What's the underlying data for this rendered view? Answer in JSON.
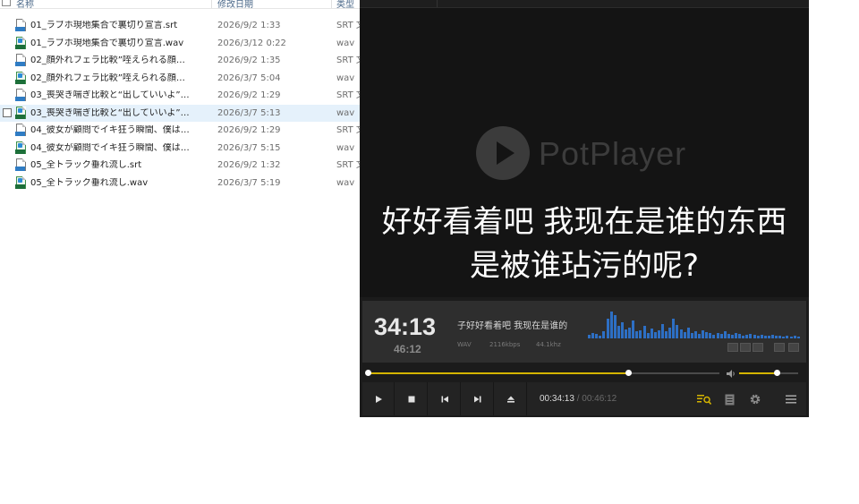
{
  "explorer": {
    "columns": [
      "名称",
      "修改日期",
      "类型"
    ],
    "files": [
      {
        "name": "01_ラブホ現地集合で裏切り宣言.srt",
        "date": "2026/9/2 1:33",
        "type": "SRT 文件",
        "kind": "srt"
      },
      {
        "name": "01_ラブホ現地集合で裏切り宣言.wav",
        "date": "2026/3/12 0:22",
        "type": "wav",
        "kind": "wav"
      },
      {
        "name": "02_顔外れフェラ比較”咥えられる顔…",
        "date": "2026/9/2 1:35",
        "type": "SRT 文件",
        "kind": "srt"
      },
      {
        "name": "02_顔外れフェラ比較”咥えられる顔…",
        "date": "2026/3/7 5:04",
        "type": "wav",
        "kind": "wav"
      },
      {
        "name": "03_喪哭き喘ぎ比較と“出していいよ”…",
        "date": "2026/9/2 1:29",
        "type": "SRT 文件",
        "kind": "srt"
      },
      {
        "name": "03_喪哭き喘ぎ比較と“出していいよ”…",
        "date": "2026/3/7 5:13",
        "type": "wav",
        "kind": "wav",
        "selected": true
      },
      {
        "name": "04_彼女が顧問でイキ狂う瞬間、僕は…",
        "date": "2026/9/2 1:29",
        "type": "SRT 文件",
        "kind": "srt"
      },
      {
        "name": "04_彼女が顧問でイキ狂う瞬間、僕は…",
        "date": "2026/3/7 5:15",
        "type": "wav",
        "kind": "wav"
      },
      {
        "name": "05_全トラック垂れ流し.srt",
        "date": "2026/9/2 1:32",
        "type": "SRT 文件",
        "kind": "srt"
      },
      {
        "name": "05_全トラック垂れ流し.wav",
        "date": "2026/3/7 5:19",
        "type": "wav",
        "kind": "wav"
      }
    ]
  },
  "player": {
    "logo_text": "PotPlayer",
    "subtitle_line1": "好好看着吧 我现在是谁的东西",
    "subtitle_line2": "是被谁玷污的呢?",
    "elapsed_big": "34:13",
    "total_small": "46:12",
    "now_playing": "子好好看着吧 我现在是谁的",
    "format": "WAV",
    "bitrate": "2116kbps",
    "samplerate": "44.1khz",
    "time_current": "00:34:13",
    "time_separator": "/",
    "time_total": "00:46:12",
    "progress": 0.7406,
    "volume": 0.63,
    "accent_color": "#d4b400",
    "eq_color": "#2d6fc4"
  }
}
